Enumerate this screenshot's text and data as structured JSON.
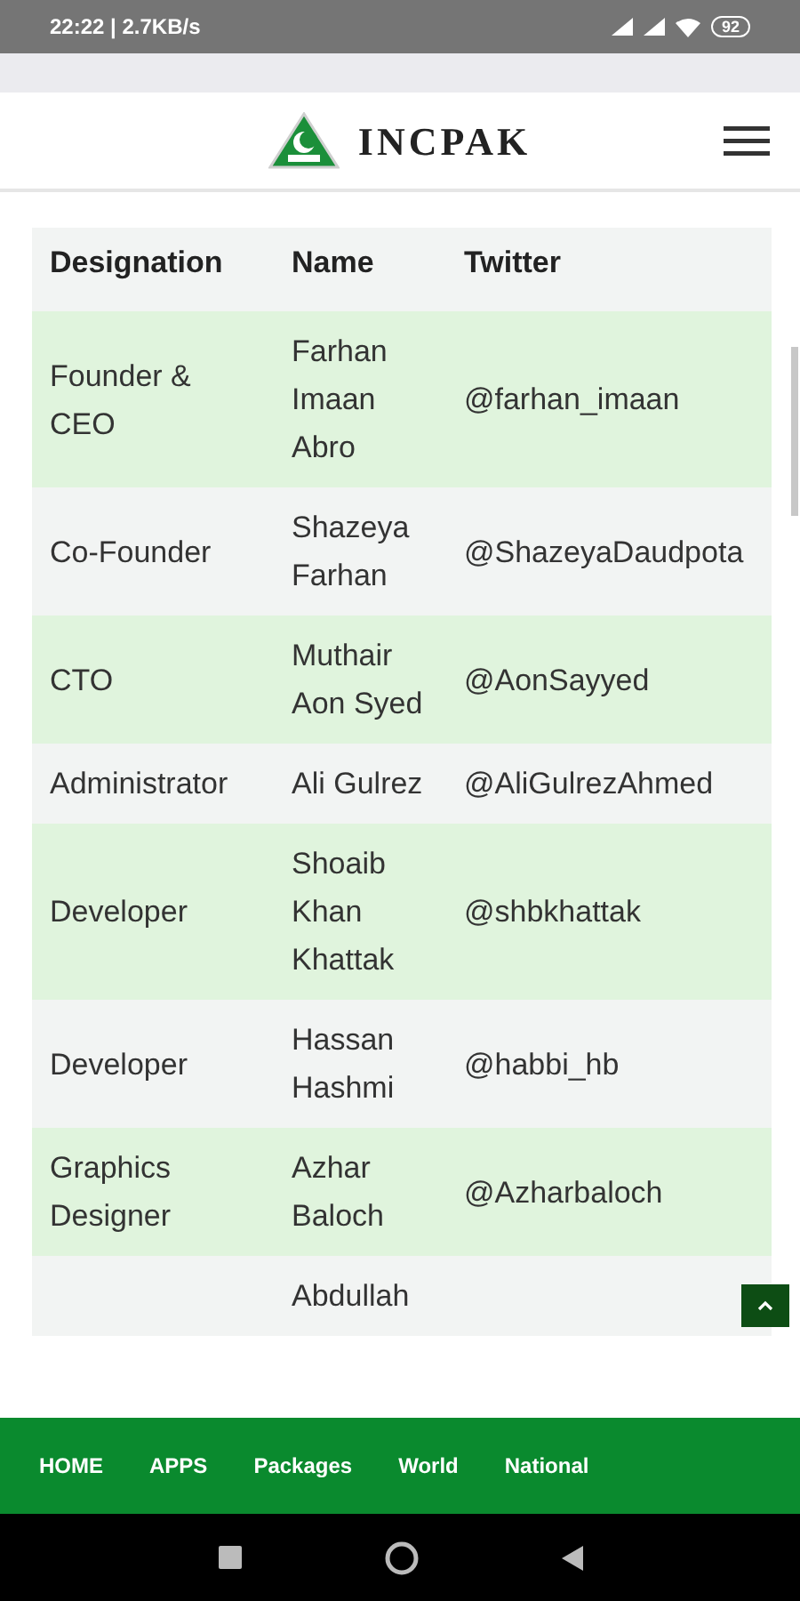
{
  "status_bar": {
    "time": "22:22 | 2.7KB/s",
    "battery": "92"
  },
  "header": {
    "title": "INCPAK"
  },
  "table": {
    "columns": [
      "Designation",
      "Name",
      "Twitter"
    ],
    "rows": [
      {
        "designation": "Founder & CEO",
        "name": "Farhan Imaan Abro",
        "twitter": "@farhan_imaan"
      },
      {
        "designation": "Co-Founder",
        "name": "Shazeya Farhan",
        "twitter": "@ShazeyaDaudpota"
      },
      {
        "designation": "CTO",
        "name": "Muthair Aon Syed",
        "twitter": "@AonSayyed"
      },
      {
        "designation": "Administrator",
        "name": "Ali Gulrez",
        "twitter": "@AliGulrezAhmed"
      },
      {
        "designation": "Developer",
        "name": "Shoaib Khan Khattak",
        "twitter": "@shbkhattak"
      },
      {
        "designation": "Developer",
        "name": "Hassan Hashmi",
        "twitter": "@habbi_hb"
      },
      {
        "designation": "Graphics Designer",
        "name": "Azhar Baloch",
        "twitter": "@Azharbaloch"
      },
      {
        "name": "Abdullah"
      }
    ]
  },
  "bottom_nav": [
    "HOME",
    "APPS",
    "Packages",
    "World",
    "National"
  ]
}
